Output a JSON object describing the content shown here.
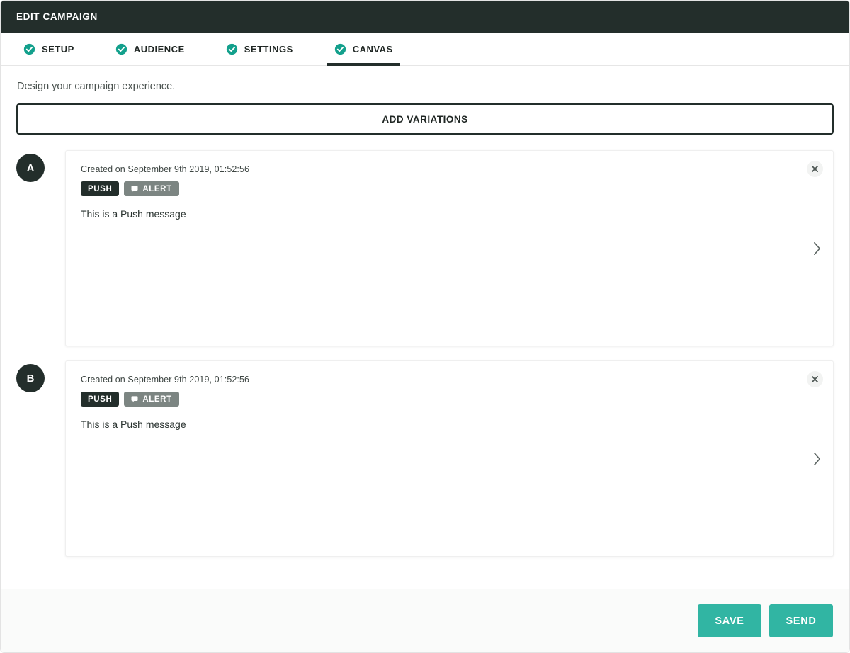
{
  "header": {
    "title": "EDIT CAMPAIGN"
  },
  "tabs": [
    {
      "label": "SETUP",
      "icon": "check-circle-icon",
      "active": false
    },
    {
      "label": "AUDIENCE",
      "icon": "check-circle-icon",
      "active": false
    },
    {
      "label": "SETTINGS",
      "icon": "check-circle-icon",
      "active": false
    },
    {
      "label": "CANVAS",
      "icon": "check-circle-icon",
      "active": true
    }
  ],
  "main": {
    "subtitle": "Design your campaign experience.",
    "add_variations_label": "ADD VARIATIONS"
  },
  "variations": [
    {
      "badge": "A",
      "created": "Created on September 9th 2019, 01:52:56",
      "chips": [
        {
          "label": "PUSH",
          "style": "dark",
          "icon": null
        },
        {
          "label": "ALERT",
          "style": "gray",
          "icon": "speech-bubble-icon"
        }
      ],
      "message": "This is a Push message",
      "close_icon": "close-icon",
      "expand_icon": "chevron-right-icon"
    },
    {
      "badge": "B",
      "created": "Created on September 9th 2019, 01:52:56",
      "chips": [
        {
          "label": "PUSH",
          "style": "dark",
          "icon": null
        },
        {
          "label": "ALERT",
          "style": "gray",
          "icon": "speech-bubble-icon"
        }
      ],
      "message": "This is a Push message",
      "close_icon": "close-icon",
      "expand_icon": "chevron-right-icon"
    }
  ],
  "footer": {
    "save_label": "SAVE",
    "send_label": "SEND"
  },
  "colors": {
    "header_bg": "#232e2b",
    "accent_teal": "#31b5a3",
    "chip_dark": "#232e2b",
    "chip_gray": "#7c8582",
    "footer_bg": "#fafbfa"
  }
}
